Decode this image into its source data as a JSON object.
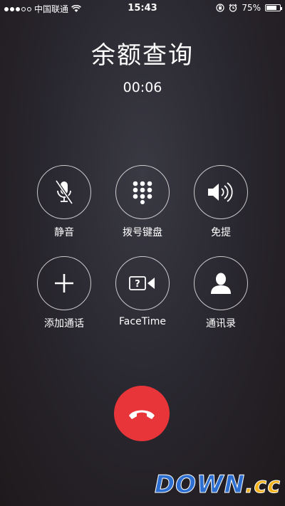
{
  "status_bar": {
    "carrier": "中国联通",
    "time": "15:43",
    "battery": "75%",
    "battery_level": 0.75,
    "icons": [
      "signal-dots-icon",
      "wifi-icon",
      "orientation-lock-icon",
      "alarm-icon",
      "battery-icon"
    ]
  },
  "call": {
    "name": "余额查询",
    "duration": "00:06"
  },
  "controls": {
    "mute": "静音",
    "keypad": "拨号键盘",
    "speaker": "免提",
    "add_call": "添加通话",
    "facetime": "FaceTime",
    "contacts": "通讯录"
  },
  "end_call": {
    "icon": "hang-up-icon",
    "color": "#e8353a"
  },
  "watermark": {
    "text_a": "DOWN",
    "text_b": ".cc"
  }
}
